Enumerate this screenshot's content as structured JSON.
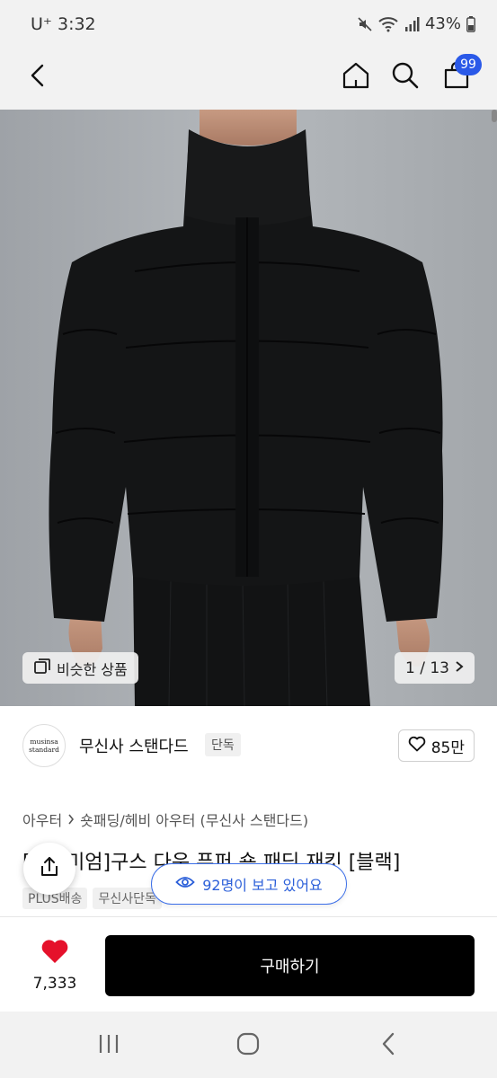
{
  "status_bar": {
    "carrier_time": "U⁺ 3:32",
    "battery": "43%",
    "icons": [
      "mute-icon",
      "wifi-icon",
      "signal-icon",
      "battery-icon"
    ]
  },
  "nav": {
    "cart_count": "99",
    "icons": [
      "back-arrow-icon",
      "home-icon",
      "search-icon",
      "cart-icon"
    ]
  },
  "gallery": {
    "similar_label": "비슷한 상품",
    "page_counter": "1 / 13"
  },
  "brand": {
    "logo_line1": "musinsa",
    "logo_line2": "standard",
    "name": "무신사 스탠다드",
    "tag": "단독",
    "likes": "85만"
  },
  "product": {
    "breadcrumb": [
      "아우터",
      "숏패딩/헤비 아우터 (무신사 스탠다드)"
    ],
    "title": "[프리미엄]구스 다운 푸퍼 숏 패딩 재킷 [블랙]",
    "chips": [
      "PLUS배송",
      "무신사단독"
    ]
  },
  "overlay": {
    "viewers": "92명이 보고 있어요"
  },
  "bottom_bar": {
    "fav_count": "7,333",
    "buy_label": "구매하기"
  },
  "colors": {
    "accent_blue": "#2a59e8",
    "heart_red": "#e5112b",
    "buy_black": "#000000"
  }
}
